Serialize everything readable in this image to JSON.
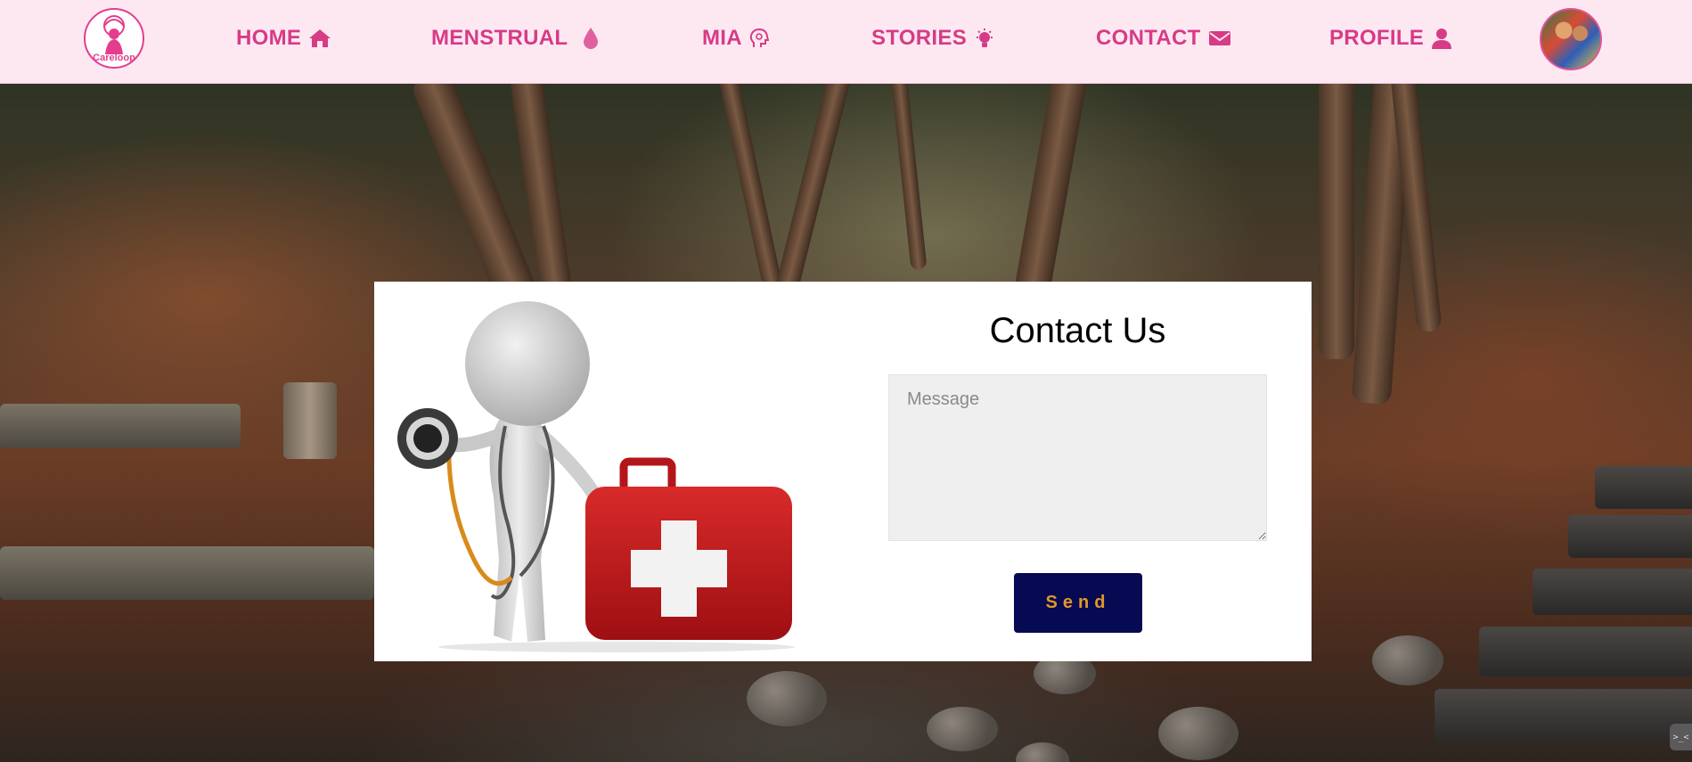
{
  "brand": {
    "logo_text": "Careloop",
    "logo_icon": "tree-woman-icon"
  },
  "nav": {
    "items": [
      {
        "label": "HOME",
        "icon": "home-icon"
      },
      {
        "label": "MENSTRUAL",
        "icon": "droplet-icon"
      },
      {
        "label": "MIA",
        "icon": "head-brain-icon"
      },
      {
        "label": "STORIES",
        "icon": "lightbulb-icon"
      },
      {
        "label": "CONTACT",
        "icon": "envelope-icon"
      },
      {
        "label": "PROFILE",
        "icon": "user-icon"
      }
    ],
    "avatar_icon": "profile-avatar"
  },
  "contact": {
    "title": "Contact Us",
    "message_placeholder": "Message",
    "message_value": "",
    "send_label": "Send",
    "illustration": "figure-with-stethoscope-and-first-aid-kit"
  },
  "corner_widget": {
    "label": ">_<"
  },
  "colors": {
    "nav_bg": "#fde8f2",
    "nav_text": "#d73b86",
    "button_bg": "#050a52",
    "button_text": "#e2962a"
  }
}
